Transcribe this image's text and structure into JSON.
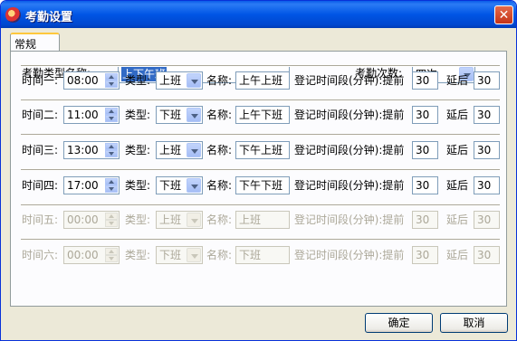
{
  "window": {
    "title": "考勤设置",
    "close_glyph": "✕"
  },
  "tabs": [
    {
      "label": "常规"
    }
  ],
  "form": {
    "type_name_label": "考勤类型名称:",
    "type_name_value": "上下午班",
    "count_label": "考勤次数:",
    "count_value": "四次"
  },
  "labels": {
    "type": "类型:",
    "name": "名称:",
    "register": "登记时间段(分钟):提前",
    "delay": "延后"
  },
  "rows": [
    {
      "label": "时间一:",
      "time": "08:00",
      "type": "上班",
      "name": "上午上班",
      "before": "30",
      "after": "30",
      "enabled": true
    },
    {
      "label": "时间二:",
      "time": "11:00",
      "type": "下班",
      "name": "上午下班",
      "before": "30",
      "after": "30",
      "enabled": true
    },
    {
      "label": "时间三:",
      "time": "13:00",
      "type": "上班",
      "name": "下午上班",
      "before": "30",
      "after": "30",
      "enabled": true
    },
    {
      "label": "时间四:",
      "time": "17:00",
      "type": "下班",
      "name": "下午下班",
      "before": "30",
      "after": "30",
      "enabled": true
    },
    {
      "label": "时间五:",
      "time": "00:00",
      "type": "上班",
      "name": "上班",
      "before": "30",
      "after": "30",
      "enabled": false
    },
    {
      "label": "时间六:",
      "time": "00:00",
      "type": "下班",
      "name": "下班",
      "before": "30",
      "after": "30",
      "enabled": false
    }
  ],
  "buttons": {
    "ok": "确定",
    "cancel": "取消"
  },
  "colors": {
    "title_bar": "#0055e5",
    "face": "#ece9d8",
    "selection": "#316ac5",
    "disabled_text": "#aca899"
  }
}
